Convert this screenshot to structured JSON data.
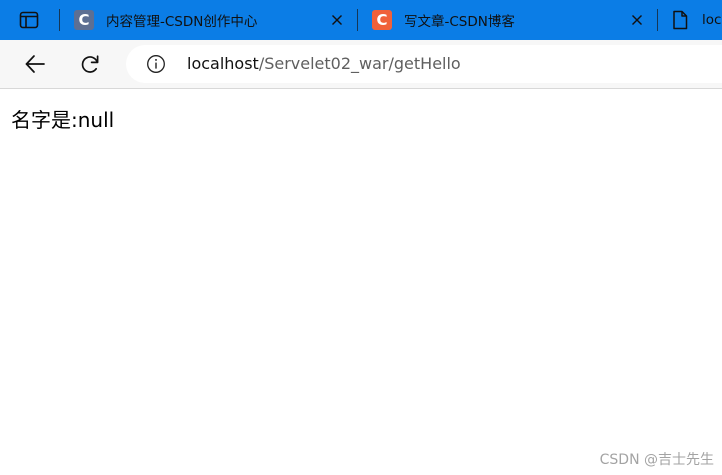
{
  "tabs": [
    {
      "title": "内容管理-CSDN创作中心",
      "favicon_letter": "C",
      "favicon_color": "#5d6f93"
    },
    {
      "title": "写文章-CSDN博客",
      "favicon_letter": "C",
      "favicon_color": "#f0613a"
    },
    {
      "title": "loc"
    }
  ],
  "toolbar": {
    "back_icon": "arrow-left-icon",
    "reload_icon": "reload-icon",
    "info_icon": "info-icon"
  },
  "address": {
    "host": "localhost",
    "path": "/Servelet02_war/getHello"
  },
  "page": {
    "body_text": "名字是:null"
  },
  "watermark": {
    "text": "CSDN @吉士先生"
  },
  "colors": {
    "tabstrip": "#0b7de6",
    "toolbar": "#f7f7f7"
  }
}
